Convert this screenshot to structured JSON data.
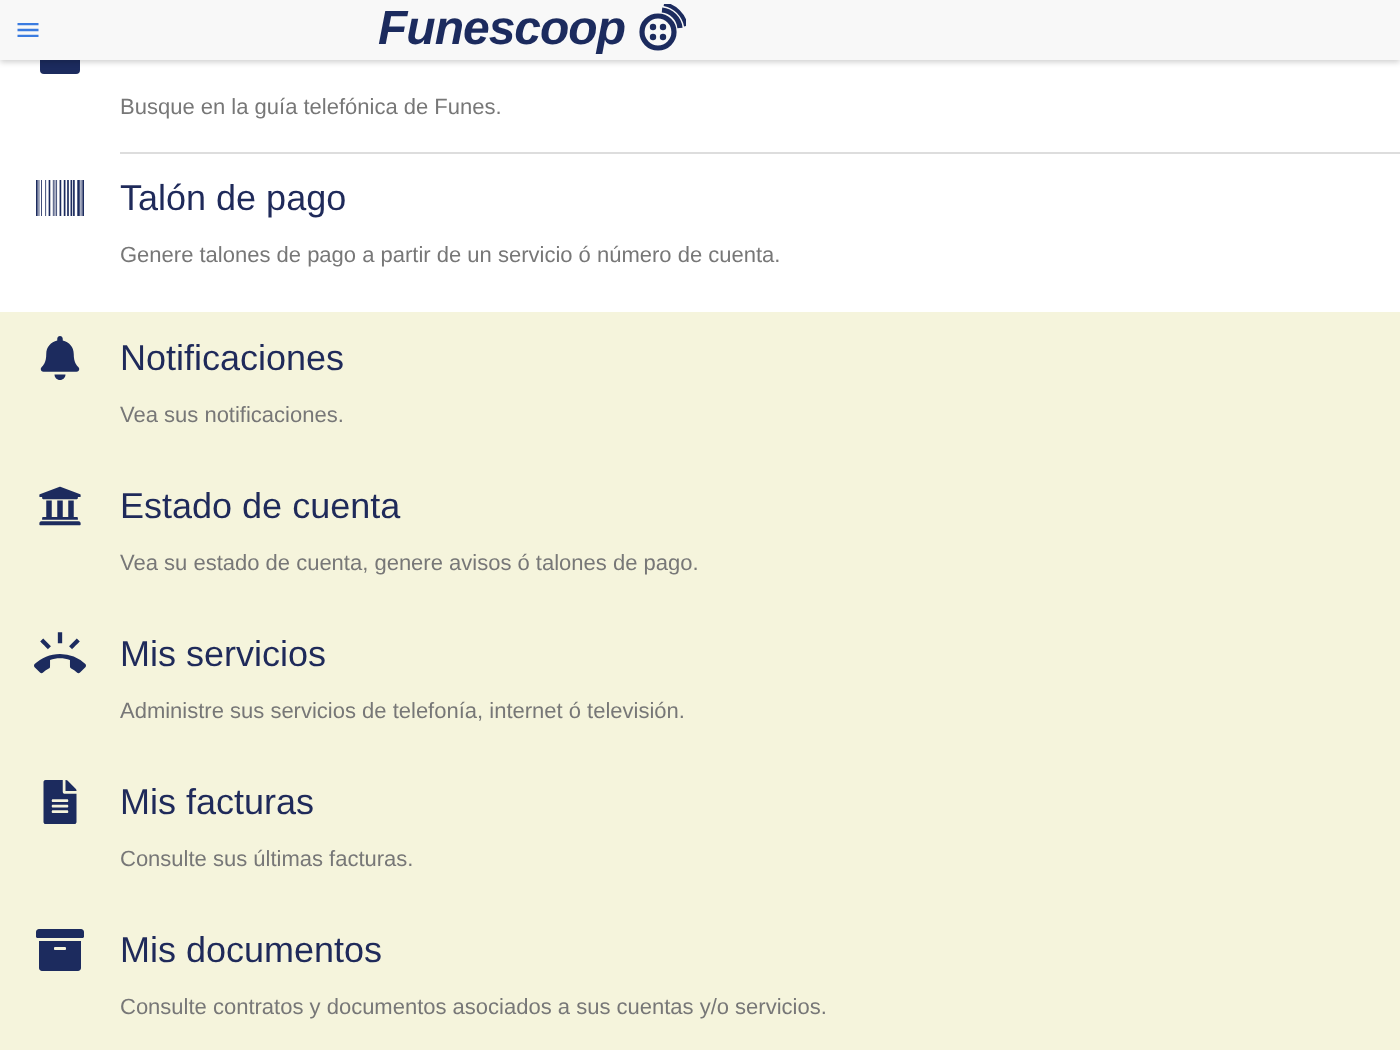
{
  "header": {
    "logo_text": "Funescoop"
  },
  "sections": [
    {
      "highlighted": false,
      "items": [
        {
          "description": "Busque en la guía telefónica de Funes."
        },
        {
          "title": "Talón de pago",
          "description": "Genere talones de pago a partir de un servicio ó número de cuenta."
        }
      ]
    },
    {
      "highlighted": true,
      "items": [
        {
          "title": "Notificaciones",
          "description": "Vea sus notificaciones."
        },
        {
          "title": "Estado de cuenta",
          "description": "Vea su estado de cuenta, genere avisos ó talones de pago."
        },
        {
          "title": "Mis servicios",
          "description": "Administre sus servicios de telefonía, internet ó televisión."
        },
        {
          "title": "Mis facturas",
          "description": "Consulte sus últimas facturas."
        },
        {
          "title": "Mis documentos",
          "description": "Consulte contratos y documentos asociados a sus cuentas y/o servicios."
        }
      ]
    }
  ]
}
